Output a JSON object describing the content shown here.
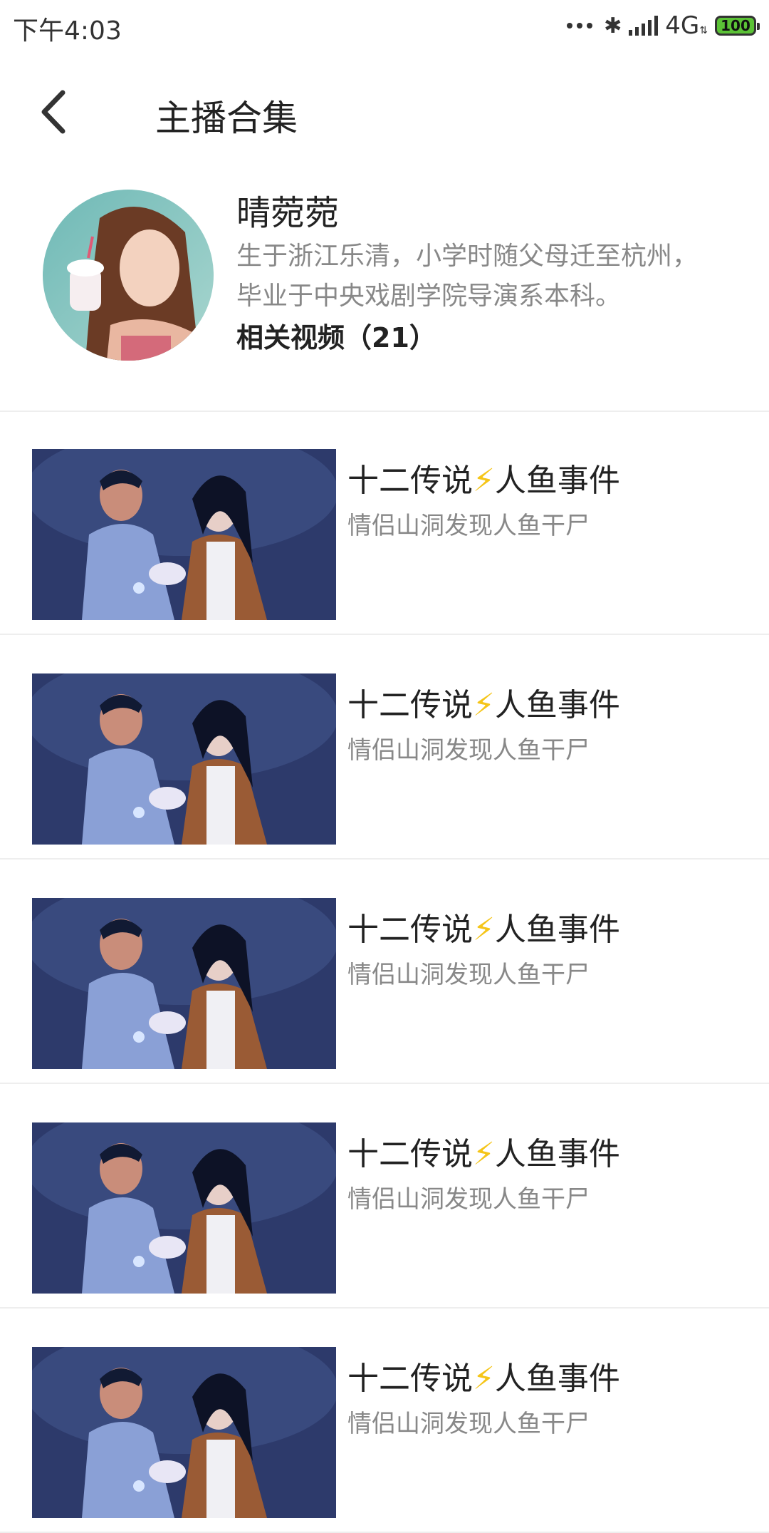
{
  "status_bar": {
    "time": "下午4:03",
    "network": "4G",
    "battery": "100"
  },
  "header": {
    "title": "主播合集"
  },
  "profile": {
    "name": "晴菀菀",
    "bio_line1": "生于浙江乐清，小学时随父母迁至杭州，",
    "bio_line2": "毕业于中央戏剧学院导演系本科。",
    "related_videos": "相关视频（21）"
  },
  "videos": [
    {
      "title_a": "十二传说",
      "bolt": "⚡",
      "title_b": "人鱼事件",
      "subtitle": "情侣山洞发现人鱼干尸"
    },
    {
      "title_a": "十二传说",
      "bolt": "⚡",
      "title_b": "人鱼事件",
      "subtitle": "情侣山洞发现人鱼干尸"
    },
    {
      "title_a": "十二传说",
      "bolt": "⚡",
      "title_b": "人鱼事件",
      "subtitle": "情侣山洞发现人鱼干尸"
    },
    {
      "title_a": "十二传说",
      "bolt": "⚡",
      "title_b": "人鱼事件",
      "subtitle": "情侣山洞发现人鱼干尸"
    },
    {
      "title_a": "十二传说",
      "bolt": "⚡",
      "title_b": "人鱼事件",
      "subtitle": "情侣山洞发现人鱼干尸"
    }
  ],
  "colors": {
    "bolt": "#f5c518",
    "battery": "#5bc236",
    "muted_text": "#888888"
  }
}
